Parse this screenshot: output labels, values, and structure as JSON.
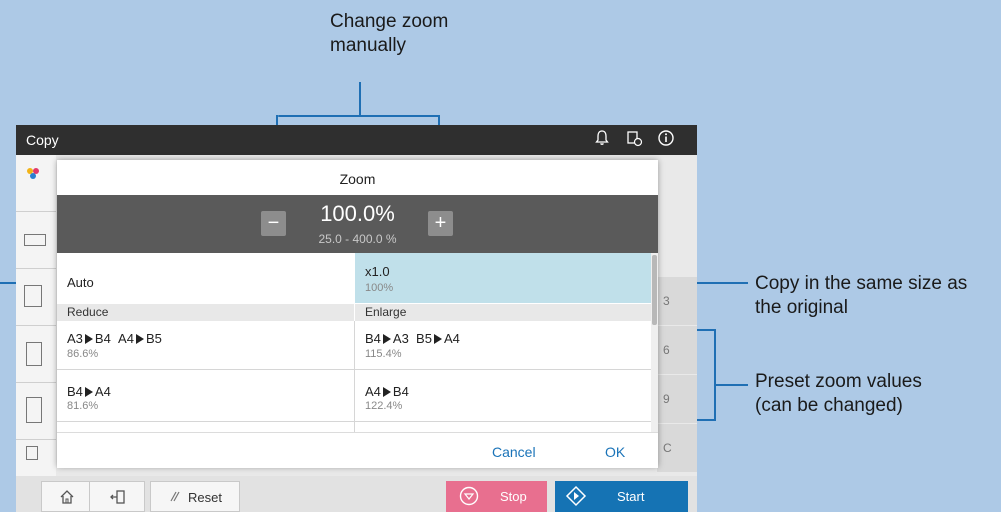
{
  "callouts": {
    "change_zoom_line1": "Change zoom",
    "change_zoom_line2": "manually",
    "same_size_line1": "Copy in the same size as",
    "same_size_line2": "the original",
    "preset_line1": "Preset zoom values",
    "preset_line2": "(can be changed)"
  },
  "app": {
    "title": "Copy",
    "icons": [
      "bell-icon",
      "device-info-icon",
      "info-icon"
    ]
  },
  "dialog": {
    "title": "Zoom",
    "zoom_value": "100.0%",
    "zoom_range": "25.0  -  400.0  %",
    "minus_label": "−",
    "plus_label": "+",
    "auto_label": "Auto",
    "same": {
      "label": "x1.0",
      "value": "100%"
    },
    "reduce_header": "Reduce",
    "enlarge_header": "Enlarge",
    "reduce": [
      {
        "a": "A3",
        "b": "B4",
        "c": "A4",
        "d": "B5",
        "value": "86.6%"
      },
      {
        "a": "B4",
        "b": "A4",
        "value": "81.6%"
      }
    ],
    "enlarge": [
      {
        "a": "B4",
        "b": "A3",
        "c": "B5",
        "d": "A4",
        "value": "115.4%"
      },
      {
        "a": "A4",
        "b": "B4",
        "value": "122.4%"
      }
    ],
    "cancel_label": "Cancel",
    "ok_label": "OK"
  },
  "background_right": [
    "3",
    "6",
    "9",
    "C"
  ],
  "bottombar": {
    "reset_label": "Reset",
    "stop_label": "Stop",
    "start_label": "Start"
  },
  "colors": {
    "accent_line": "#1f6fb4",
    "selected_cell": "#c0e0ea",
    "stop_button": "#e86f8f",
    "start_button": "#1573b4"
  }
}
